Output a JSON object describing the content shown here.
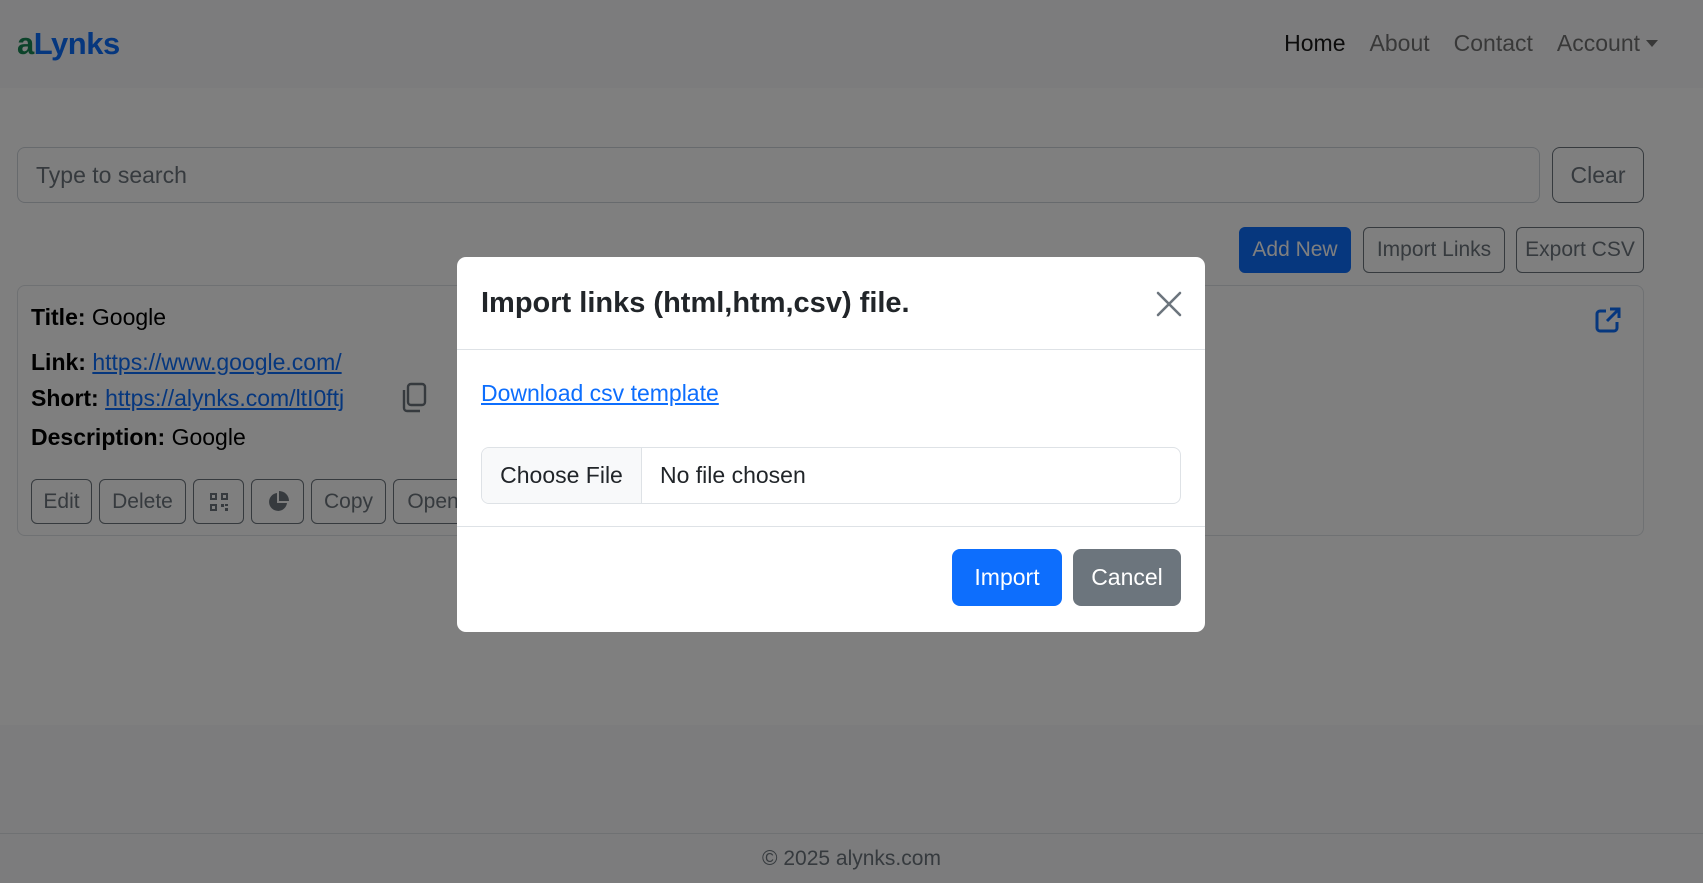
{
  "brand": {
    "part1": "a",
    "part2": "Lynks"
  },
  "nav": {
    "home": "Home",
    "about": "About",
    "contact": "Contact",
    "account": "Account"
  },
  "search": {
    "placeholder": "Type to search",
    "value": ""
  },
  "toolbar": {
    "clear": "Clear",
    "add_new": "Add New",
    "import_links": "Import Links",
    "export_csv": "Export CSV"
  },
  "card": {
    "title_label": "Title:",
    "title_value": "Google",
    "link_label": "Link:",
    "link_value": "https://www.google.com/",
    "short_label": "Short:",
    "short_value": "https://alynks.com/ltI0ftj",
    "description_label": "Description:",
    "description_value": "Google",
    "buttons": {
      "edit": "Edit",
      "delete": "Delete",
      "copy": "Copy",
      "open": "Open"
    }
  },
  "footer": {
    "text": "© 2025 alynks.com"
  },
  "modal": {
    "title": "Import links (html,htm,csv) file.",
    "download_link": "Download csv template",
    "choose_file": "Choose File",
    "file_status": "No file chosen",
    "import_button": "Import",
    "cancel_button": "Cancel"
  },
  "colors": {
    "primary": "#0d6efd",
    "secondary": "#6c757d",
    "brand_green": "#198754"
  }
}
